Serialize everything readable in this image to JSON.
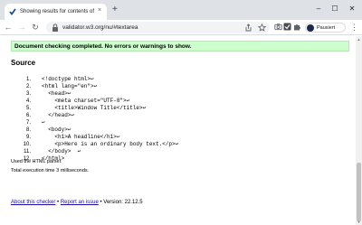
{
  "browser": {
    "tab_title": "Showing results for contents of t",
    "tab_close": "×",
    "new_tab": "+",
    "url": "validator.w3.org/nu/#textarea",
    "profile_label": "Pausiert",
    "menu": "⋮",
    "window_controls": {
      "minimize": "–",
      "maximize": "☐",
      "close": "✕"
    },
    "nav": {
      "back": "←",
      "forward": "→",
      "reload": "↻"
    }
  },
  "page": {
    "success_message": "Document checking completed. No errors or warnings to show.",
    "source_heading": "Source",
    "source_lines": [
      {
        "n": "1.",
        "text": "<!doctype html>↩"
      },
      {
        "n": "2.",
        "text": "<html lang=\"en\">↩"
      },
      {
        "n": "3.",
        "text": "  <head>↩"
      },
      {
        "n": "4.",
        "text": "    <meta charset=\"UTF-8\">↩"
      },
      {
        "n": "5.",
        "text": "    <title>Window Title</title>↩"
      },
      {
        "n": "6.",
        "text": "  </head>↩"
      },
      {
        "n": "7.",
        "text": "↩"
      },
      {
        "n": "8.",
        "text": "  <body>↩"
      },
      {
        "n": "9.",
        "text": "    <h1>A headline</h1>↩"
      },
      {
        "n": "10.",
        "text": "    <p>Here is an ordinary body text.</p>↩"
      },
      {
        "n": "11.",
        "text": "  </body>  ↩"
      },
      {
        "n": "12.",
        "text": "</html>"
      }
    ],
    "parser_note": "Used the HTML parser.",
    "execution_time": "Total execution time 3 milliseconds.",
    "footer": {
      "about_link": "About this checker",
      "separator": "•",
      "report_link": "Report an issue",
      "version": "• Version: 22.12.5"
    }
  }
}
